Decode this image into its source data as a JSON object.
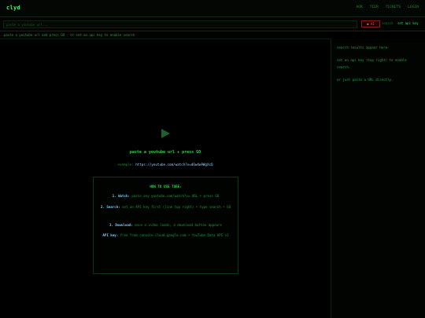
{
  "app": {
    "logo": "clyd"
  },
  "nav": {
    "links": [
      "AGR",
      "TIER",
      "TICKETS",
      "LOGIN"
    ]
  },
  "toolbar": {
    "url_placeholder": "paste a youtube url...",
    "ai_label": "● AI",
    "search_label": "search",
    "set_key_label": "set api key"
  },
  "hint": {
    "text": "paste a youtube url and press GO · or set an api key to enable search"
  },
  "player": {
    "play_icon": "play-icon",
    "prompt": "paste a youtube url + press GO",
    "example_label": "example:",
    "example_url": "https://youtube.com/watch?v=dQw4w9WgXcQ",
    "howto_title": "HOW TO USE TUBE:",
    "steps": [
      {
        "label": "1. Watch:",
        "text": "paste any youtube.com/watch?v= URL + press GO"
      },
      {
        "label": "2. Search:",
        "text": "set an API key first (line top right) + type search + GO"
      },
      {
        "label": "3. Download:",
        "text": "once a video loads, a download button appears"
      },
      {
        "label": "API key:",
        "text": "free from console.cloud.google.com + YouTube Data API v3"
      }
    ]
  },
  "sidebar": {
    "line1": "search results appear here.",
    "line2": "set an api key (top right) to enable search.",
    "line3": "or just paste a URL directly."
  },
  "colors": {
    "background": "#000000",
    "accent_green": "#2cd34f",
    "link_blue": "#9ed6ff",
    "warning_red": "#ff4b4b"
  }
}
